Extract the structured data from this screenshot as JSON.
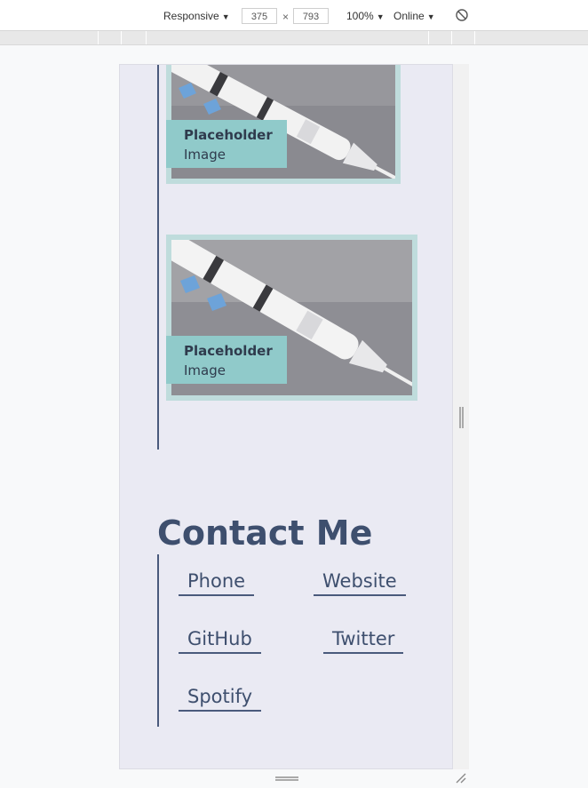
{
  "devtools": {
    "device_mode": "Responsive",
    "width": "375",
    "height": "793",
    "times": "×",
    "zoom": "100%",
    "network": "Online",
    "rotate_icon": "rotate-icon"
  },
  "gallery": {
    "cards": [
      {
        "caption_title": "Placeholder",
        "caption_sub": "Image"
      },
      {
        "caption_title": "Placeholder",
        "caption_sub": "Image"
      }
    ]
  },
  "contact": {
    "title": "Contact Me",
    "links": [
      {
        "label": "Phone"
      },
      {
        "label": "Website"
      },
      {
        "label": "GitHub"
      },
      {
        "label": "Twitter"
      },
      {
        "label": "Spotify"
      }
    ]
  },
  "colors": {
    "page_bg": "#eaeaf3",
    "accent": "#3e4f6e",
    "caption_bg": "#90caca",
    "card_border": "#bfdcdc"
  }
}
